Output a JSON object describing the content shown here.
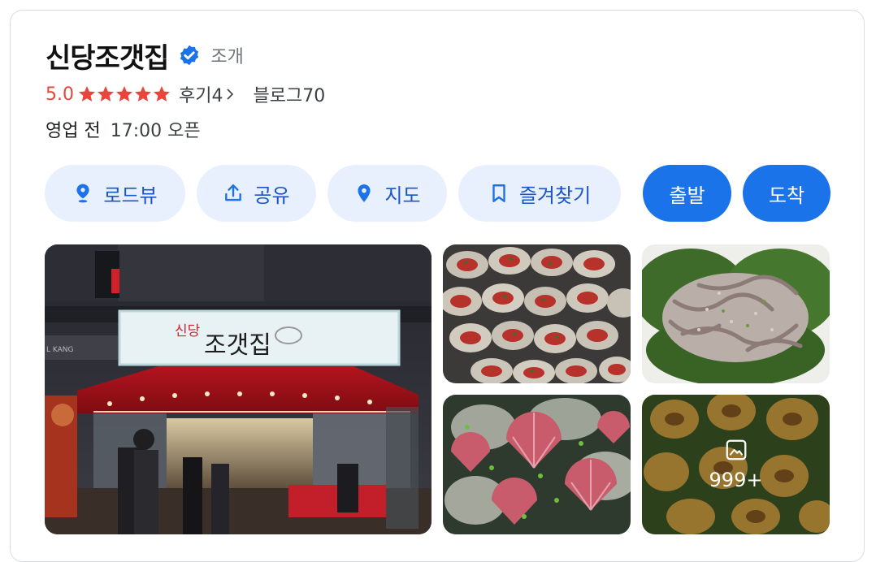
{
  "place": {
    "name": "신당조갯집",
    "category": "조개",
    "rating": "5.0",
    "stars": 5,
    "reviews_label": "후기4",
    "blog_label": "블로그70",
    "hours_status": "영업 전",
    "hours_time": "17:00 오픈"
  },
  "actions": {
    "roadview": "로드뷰",
    "share": "공유",
    "map": "지도",
    "bookmark": "즐겨찾기",
    "depart": "출발",
    "arrive": "도착"
  },
  "photos": {
    "more_count": "999+",
    "sign_text_small": "신당",
    "sign_text_large": "조갯집",
    "storefront_side_text": "L KANG"
  },
  "colors": {
    "accent": "#1a73e8",
    "rating": "#e8453c",
    "chip_bg": "#e8f0fe"
  }
}
